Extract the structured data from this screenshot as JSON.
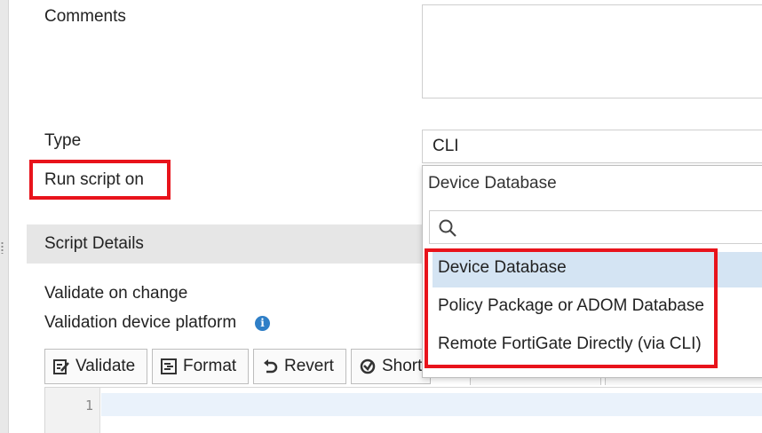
{
  "form": {
    "comments_label": "Comments",
    "type_label": "Type",
    "type_value": "CLI",
    "run_script_label": "Run script on"
  },
  "section": {
    "title": "Script Details",
    "validate_on_change_label": "Validate on change",
    "validation_platform_label": "Validation device platform",
    "info_glyph": "i"
  },
  "toolbar": {
    "validate_label": "Validate",
    "format_label": "Format",
    "revert_label": "Revert",
    "shortcuts_label": "Short"
  },
  "editor": {
    "line_number": "1"
  },
  "dropdown": {
    "selected_value": "Device Database",
    "search_placeholder": "",
    "options": [
      {
        "label": "Device Database",
        "active": true
      },
      {
        "label": "Policy Package or ADOM Database",
        "active": false
      },
      {
        "label": "Remote FortiGate Directly (via CLI)",
        "active": false
      }
    ]
  },
  "colors": {
    "highlight": "#e8131b",
    "active_option": "#d4e4f3",
    "info_icon": "#2f7fc7"
  }
}
